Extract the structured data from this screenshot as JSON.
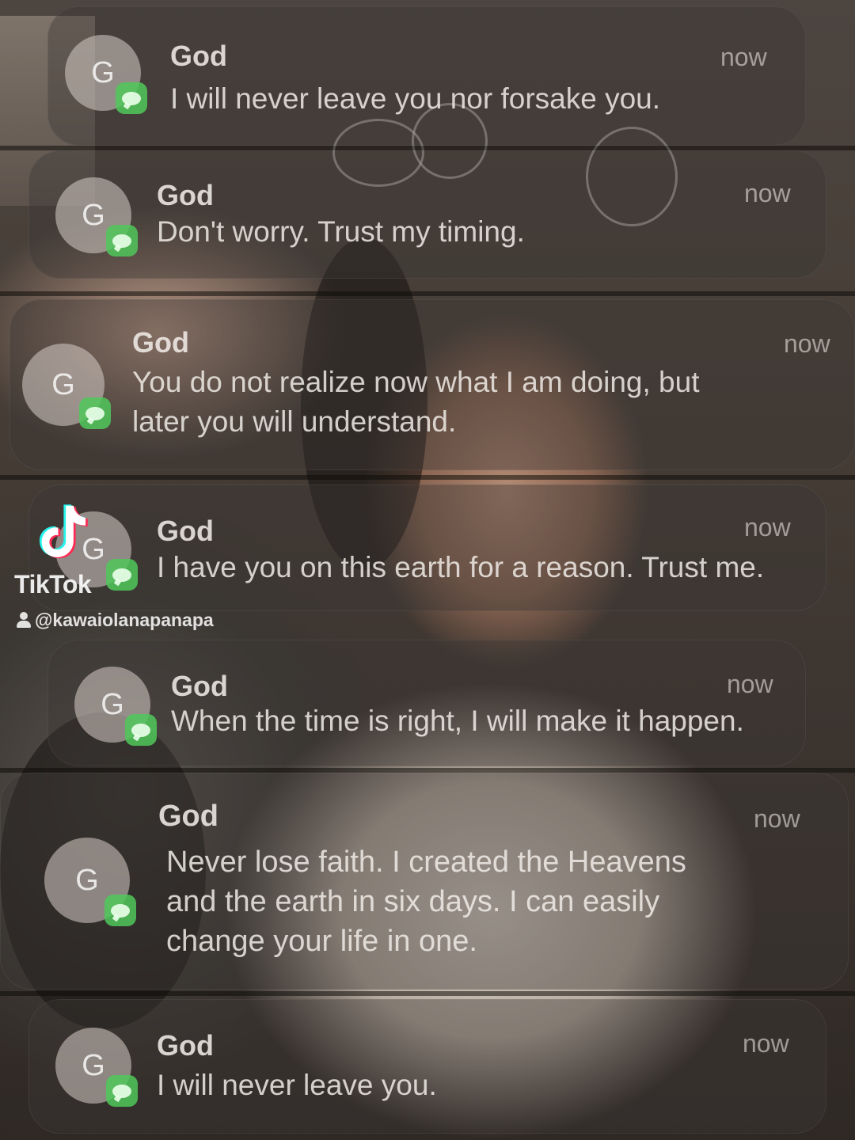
{
  "notifications": [
    {
      "sender": "God",
      "avatar_letter": "G",
      "time": "now",
      "message": "I will never leave you nor forsake you."
    },
    {
      "sender": "God",
      "avatar_letter": "G",
      "time": "now",
      "message": "Don't worry. Trust my timing."
    },
    {
      "sender": "God",
      "avatar_letter": "G",
      "time": "now",
      "message": "You do not realize now what I am doing, but\nlater you will understand."
    },
    {
      "sender": "God",
      "avatar_letter": "G",
      "time": "now",
      "message": "I have you on this earth for a reason. Trust me."
    },
    {
      "sender": "God",
      "avatar_letter": "G",
      "time": "now",
      "message": "When the time is right, I will make it happen."
    },
    {
      "sender": "God",
      "avatar_letter": "G",
      "time": "now",
      "message": "Never lose faith. I created the Heavens\nand the earth in six days. I can easily\nchange your life in one."
    },
    {
      "sender": "God",
      "avatar_letter": "G",
      "time": "now",
      "message": "I will never leave you."
    }
  ],
  "watermark": {
    "brand": "TikTok",
    "handle": "@kawaiolanapanapa",
    "icon": "tiktok-logo-icon"
  },
  "app_icon": "messages-icon"
}
